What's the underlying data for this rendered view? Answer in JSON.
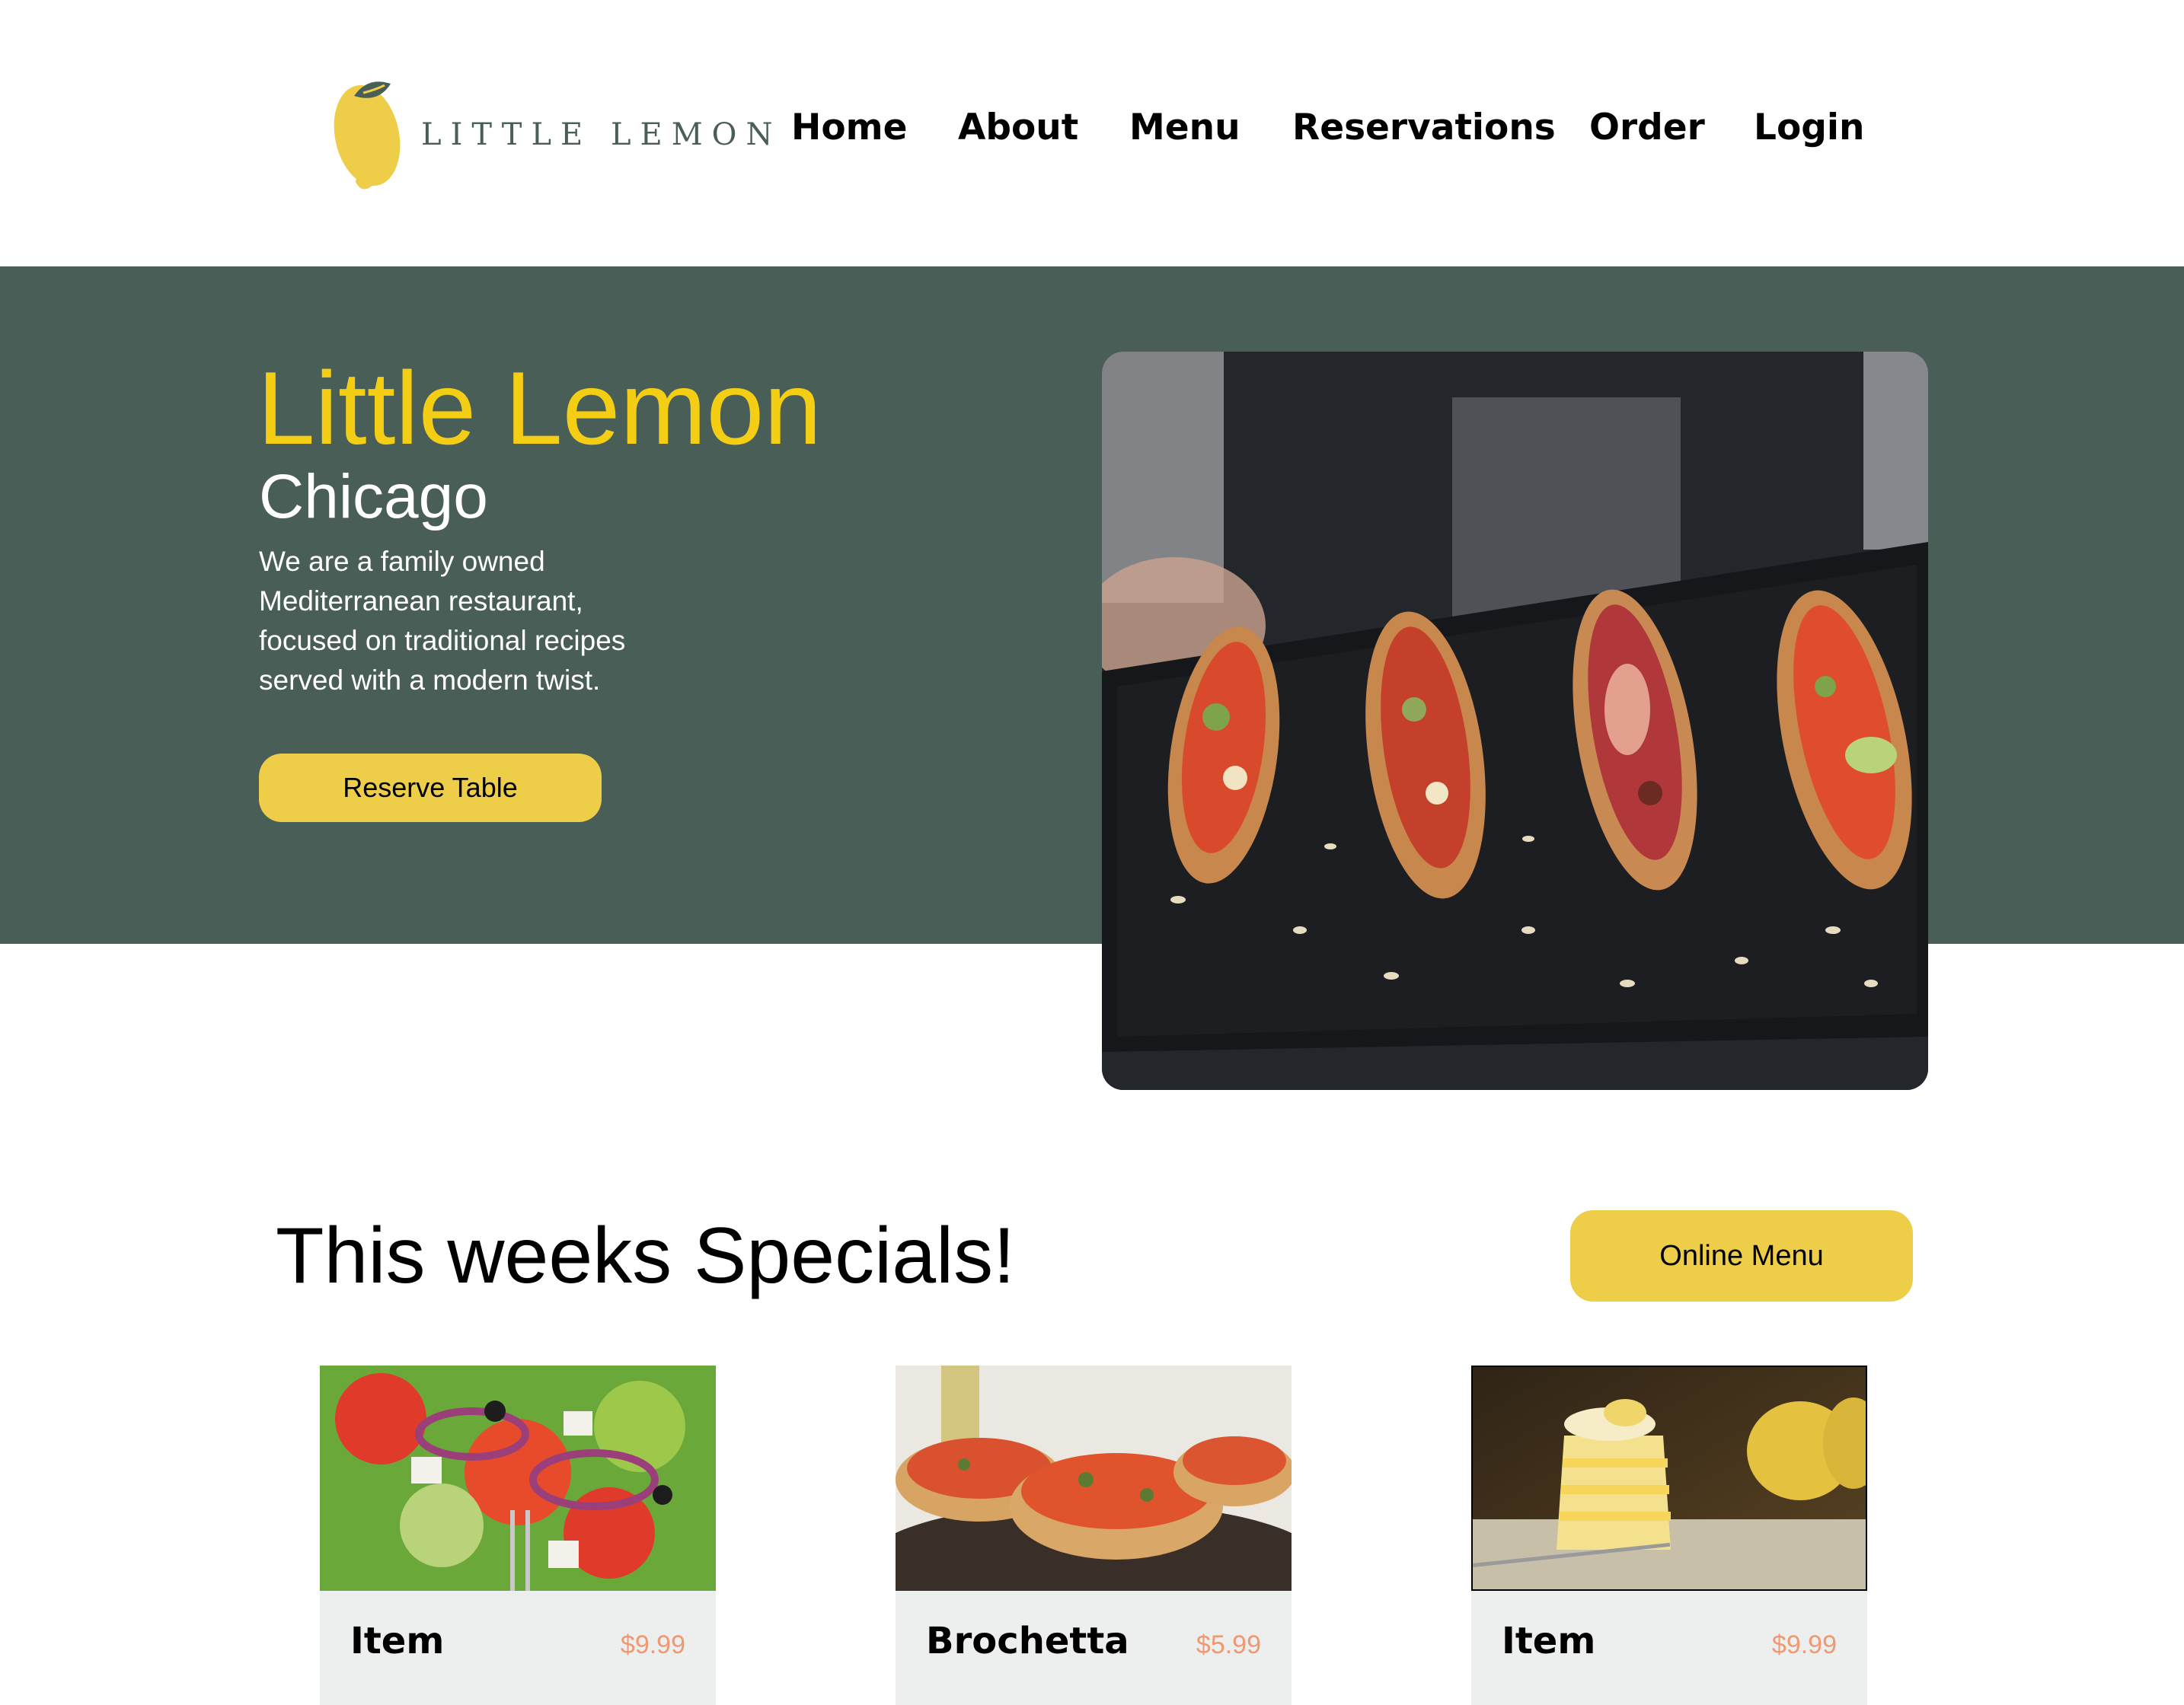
{
  "brand": {
    "logo_text": "LITTLE LEMON",
    "logo_icon": "lemon-icon",
    "color_primary_green": "#495e57",
    "color_primary_yellow": "#f4ce14",
    "color_button": "#eecd49",
    "color_price": "#ee9972"
  },
  "nav": {
    "items": [
      {
        "label": "Home"
      },
      {
        "label": "About"
      },
      {
        "label": "Menu"
      },
      {
        "label": "Reservations"
      },
      {
        "label": "Order"
      },
      {
        "label": "Login"
      }
    ]
  },
  "hero": {
    "title": "Little Lemon",
    "subtitle": "Chicago",
    "description": "We are a family owned Mediterranean restaurant, focused on traditional recipes served with a modern twist.",
    "cta_label": "Reserve Table"
  },
  "specials": {
    "title": "This weeks Specials!",
    "menu_button_label": "Online Menu",
    "items": [
      {
        "name": "Item",
        "price": "$9.99"
      },
      {
        "name": "Brochetta",
        "price": "$5.99"
      },
      {
        "name": "Item",
        "price": "$9.99"
      }
    ]
  }
}
